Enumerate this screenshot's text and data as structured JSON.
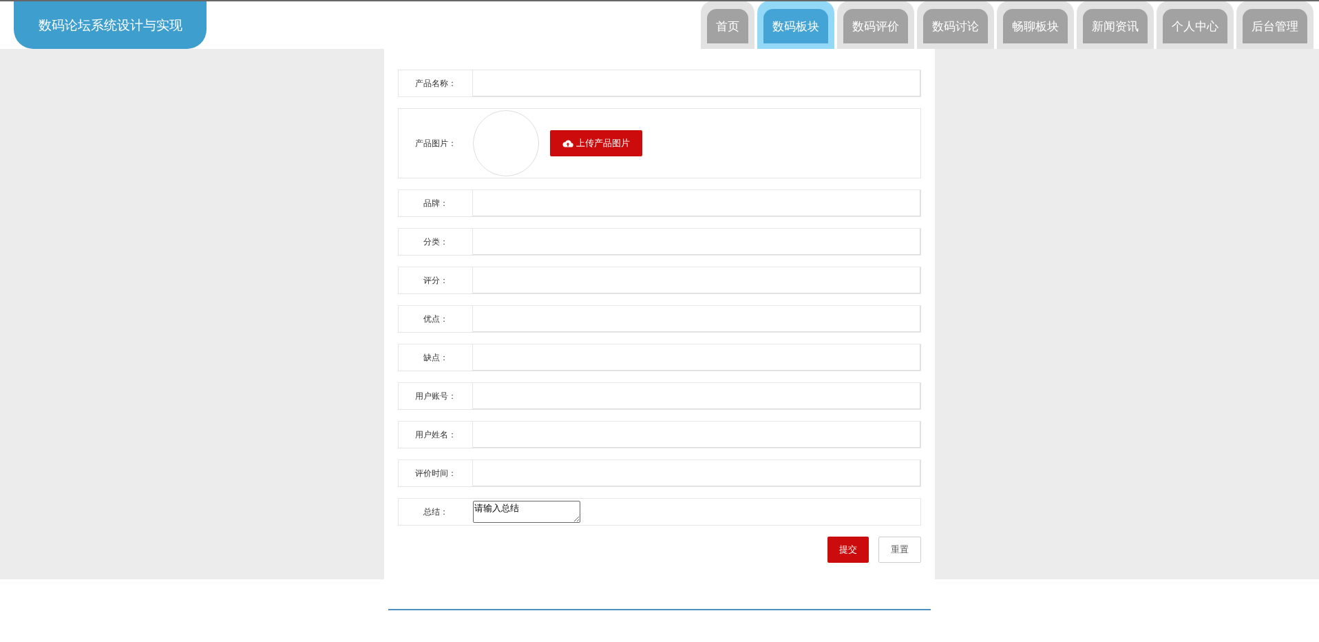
{
  "header": {
    "title": "数码论坛系统设计与实现"
  },
  "nav": [
    {
      "label": "首页",
      "selected": false
    },
    {
      "label": "数码板块",
      "selected": true
    },
    {
      "label": "数码评价",
      "selected": false
    },
    {
      "label": "数码讨论",
      "selected": false
    },
    {
      "label": "畅聊板块",
      "selected": false
    },
    {
      "label": "新闻资讯",
      "selected": false
    },
    {
      "label": "个人中心",
      "selected": false
    },
    {
      "label": "后台管理",
      "selected": false
    }
  ],
  "form": {
    "fields": [
      {
        "kind": "text",
        "label": "产品名称："
      },
      {
        "kind": "image",
        "label": "产品图片：",
        "button": "上传产品图片"
      },
      {
        "kind": "text",
        "label": "品牌："
      },
      {
        "kind": "text",
        "label": "分类："
      },
      {
        "kind": "text",
        "label": "评分："
      },
      {
        "kind": "text",
        "label": "优点："
      },
      {
        "kind": "text",
        "label": "缺点："
      },
      {
        "kind": "text",
        "label": "用户账号："
      },
      {
        "kind": "text",
        "label": "用户姓名："
      },
      {
        "kind": "text",
        "label": "评价时间："
      },
      {
        "kind": "textarea",
        "label": "总结：",
        "value": "请输入总结"
      }
    ],
    "buttons": [
      {
        "kind": "primary",
        "label": "提交"
      },
      {
        "kind": "plain",
        "label": "重置"
      }
    ]
  }
}
